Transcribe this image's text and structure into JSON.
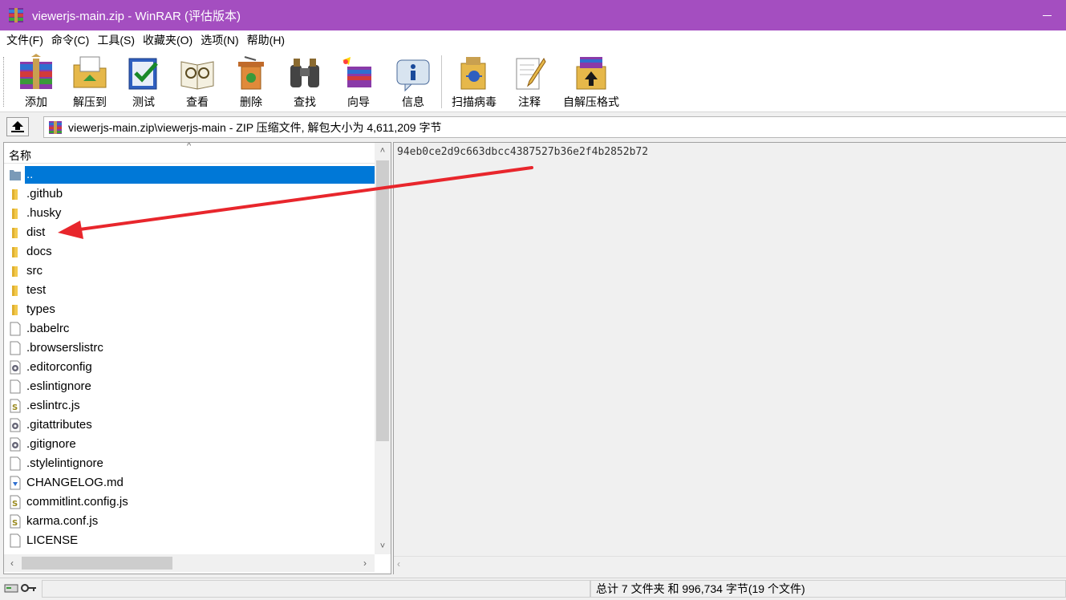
{
  "window": {
    "title": "viewerjs-main.zip - WinRAR (评估版本)"
  },
  "menu": [
    "文件(F)",
    "命令(C)",
    "工具(S)",
    "收藏夹(O)",
    "选项(N)",
    "帮助(H)"
  ],
  "toolbar": [
    {
      "label": "添加",
      "icon": "add-archive-icon"
    },
    {
      "label": "解压到",
      "icon": "extract-to-icon"
    },
    {
      "label": "测试",
      "icon": "test-icon"
    },
    {
      "label": "查看",
      "icon": "view-icon"
    },
    {
      "label": "删除",
      "icon": "delete-icon"
    },
    {
      "label": "查找",
      "icon": "find-icon"
    },
    {
      "label": "向导",
      "icon": "wizard-icon"
    },
    {
      "label": "信息",
      "icon": "info-icon"
    },
    {
      "label": "扫描病毒",
      "icon": "virus-scan-icon"
    },
    {
      "label": "注释",
      "icon": "comment-icon"
    },
    {
      "label": "自解压格式",
      "icon": "sfx-icon"
    }
  ],
  "address": {
    "path": "viewerjs-main.zip\\viewerjs-main - ZIP 压缩文件, 解包大小为 4,611,209 字节"
  },
  "filelist": {
    "column": "名称",
    "rows": [
      {
        "name": "..",
        "type": "parent",
        "selected": true
      },
      {
        "name": ".github",
        "type": "folder"
      },
      {
        "name": ".husky",
        "type": "folder"
      },
      {
        "name": "dist",
        "type": "folder"
      },
      {
        "name": "docs",
        "type": "folder"
      },
      {
        "name": "src",
        "type": "folder"
      },
      {
        "name": "test",
        "type": "folder"
      },
      {
        "name": "types",
        "type": "folder"
      },
      {
        "name": ".babelrc",
        "type": "file"
      },
      {
        "name": ".browserslistrc",
        "type": "file"
      },
      {
        "name": ".editorconfig",
        "type": "config"
      },
      {
        "name": ".eslintignore",
        "type": "file"
      },
      {
        "name": ".eslintrc.js",
        "type": "js"
      },
      {
        "name": ".gitattributes",
        "type": "config"
      },
      {
        "name": ".gitignore",
        "type": "config"
      },
      {
        "name": ".stylelintignore",
        "type": "file"
      },
      {
        "name": "CHANGELOG.md",
        "type": "md"
      },
      {
        "name": "commitlint.config.js",
        "type": "js"
      },
      {
        "name": "karma.conf.js",
        "type": "js"
      },
      {
        "name": "LICENSE",
        "type": "file"
      }
    ]
  },
  "comment": {
    "text": "94eb0ce2d9c663dbcc4387527b36e2f4b2852b72"
  },
  "status": {
    "summary": "总计 7 文件夹 和 996,734 字节(19 个文件)"
  },
  "colors": {
    "titlebar": "#a44ec0",
    "selection": "#0078d7",
    "annotation": "#e8262c"
  }
}
